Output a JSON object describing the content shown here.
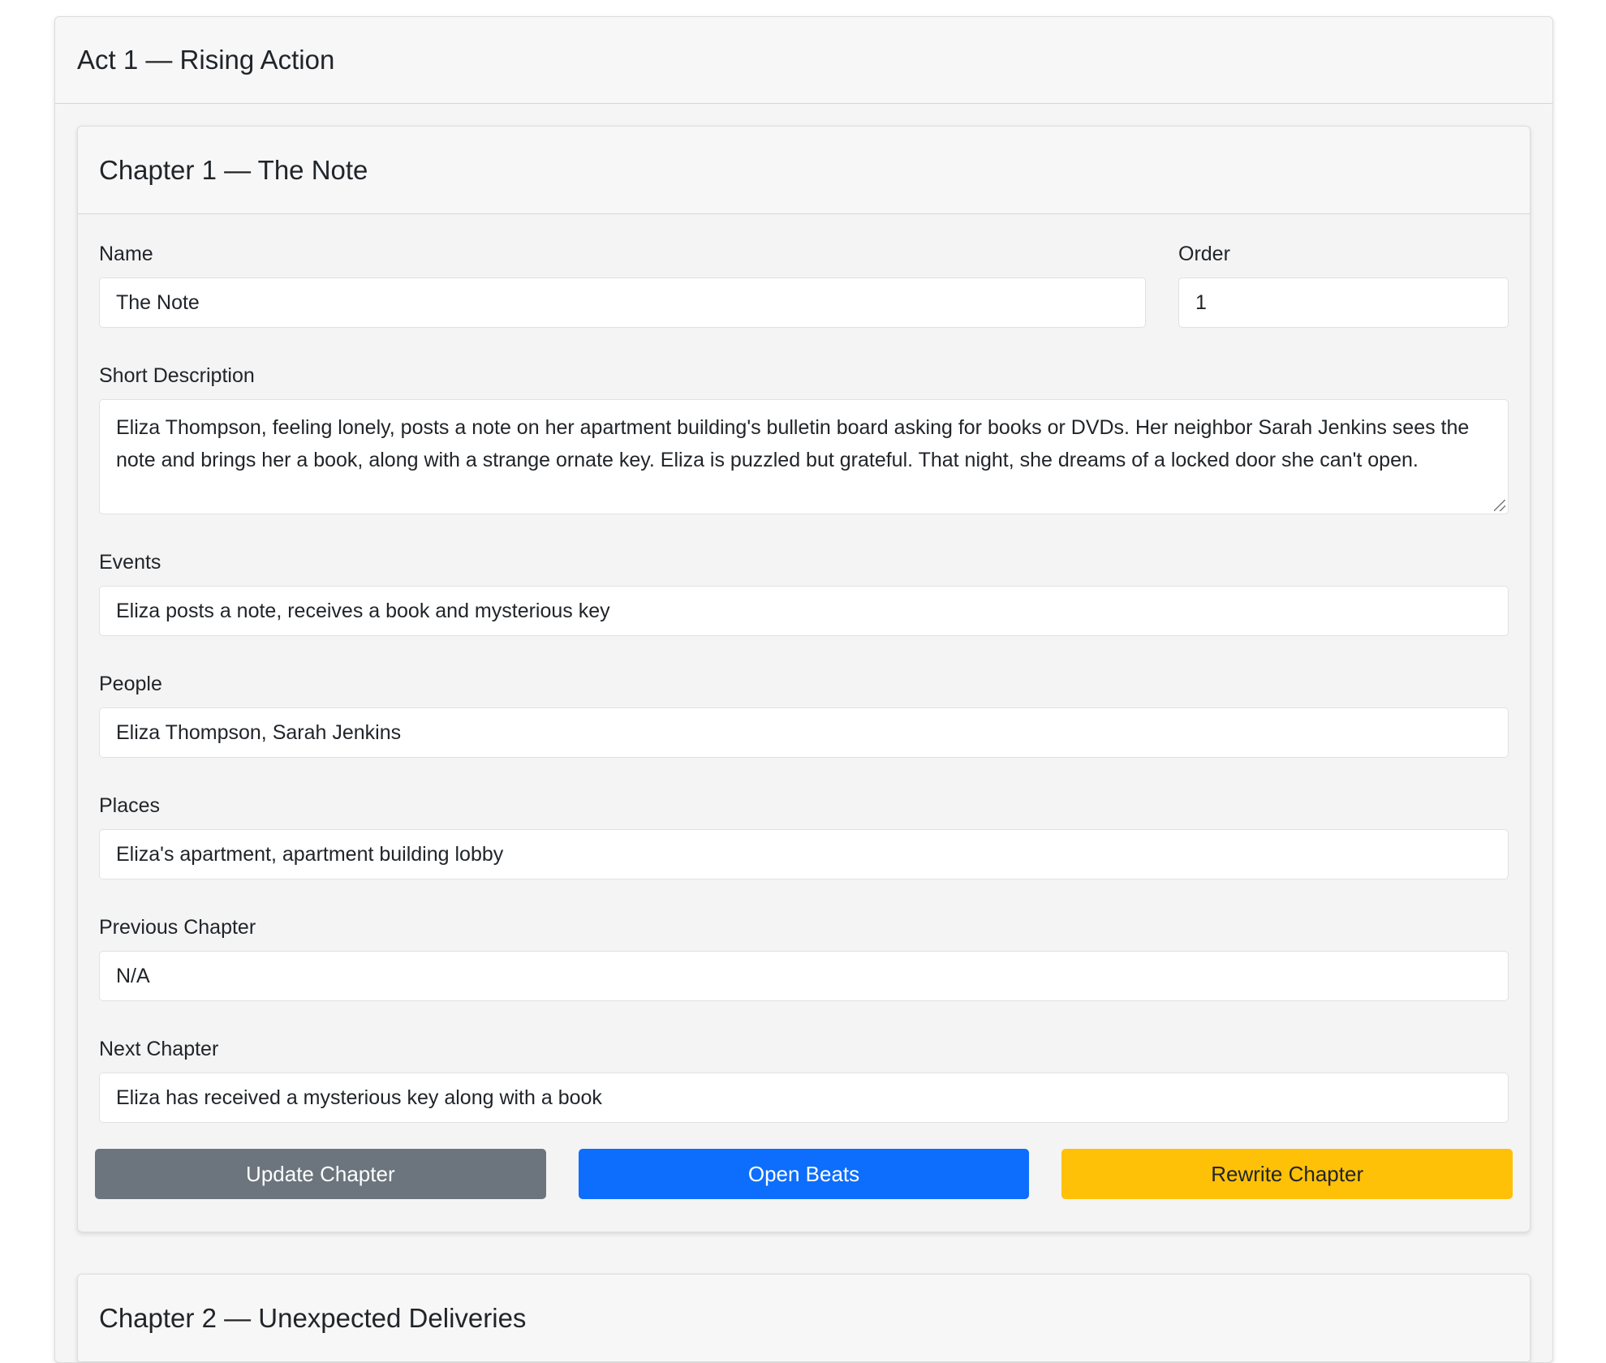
{
  "act": {
    "title": "Act 1 — Rising Action"
  },
  "chapters": [
    {
      "title": "Chapter 1 — The Note",
      "labels": {
        "name": "Name",
        "order": "Order",
        "short_description": "Short Description",
        "events": "Events",
        "people": "People",
        "places": "Places",
        "previous_chapter": "Previous Chapter",
        "next_chapter": "Next Chapter"
      },
      "values": {
        "name": "The Note",
        "order": "1",
        "short_description": "Eliza Thompson, feeling lonely, posts a note on her apartment building's bulletin board asking for books or DVDs. Her neighbor Sarah Jenkins sees the note and brings her a book, along with a strange ornate key. Eliza is puzzled but grateful. That night, she dreams of a locked door she can't open.",
        "events": "Eliza posts a note, receives a book and mysterious key",
        "people": "Eliza Thompson, Sarah Jenkins",
        "places": "Eliza's apartment, apartment building lobby",
        "previous_chapter": "N/A",
        "next_chapter": "Eliza has received a mysterious key along with a book"
      },
      "buttons": {
        "update": "Update Chapter",
        "open_beats": "Open Beats",
        "rewrite": "Rewrite Chapter"
      }
    },
    {
      "title": "Chapter 2 — Unexpected Deliveries"
    }
  ],
  "colors": {
    "secondary": "#6c757d",
    "primary": "#0d6efd",
    "warning": "#ffc107"
  }
}
